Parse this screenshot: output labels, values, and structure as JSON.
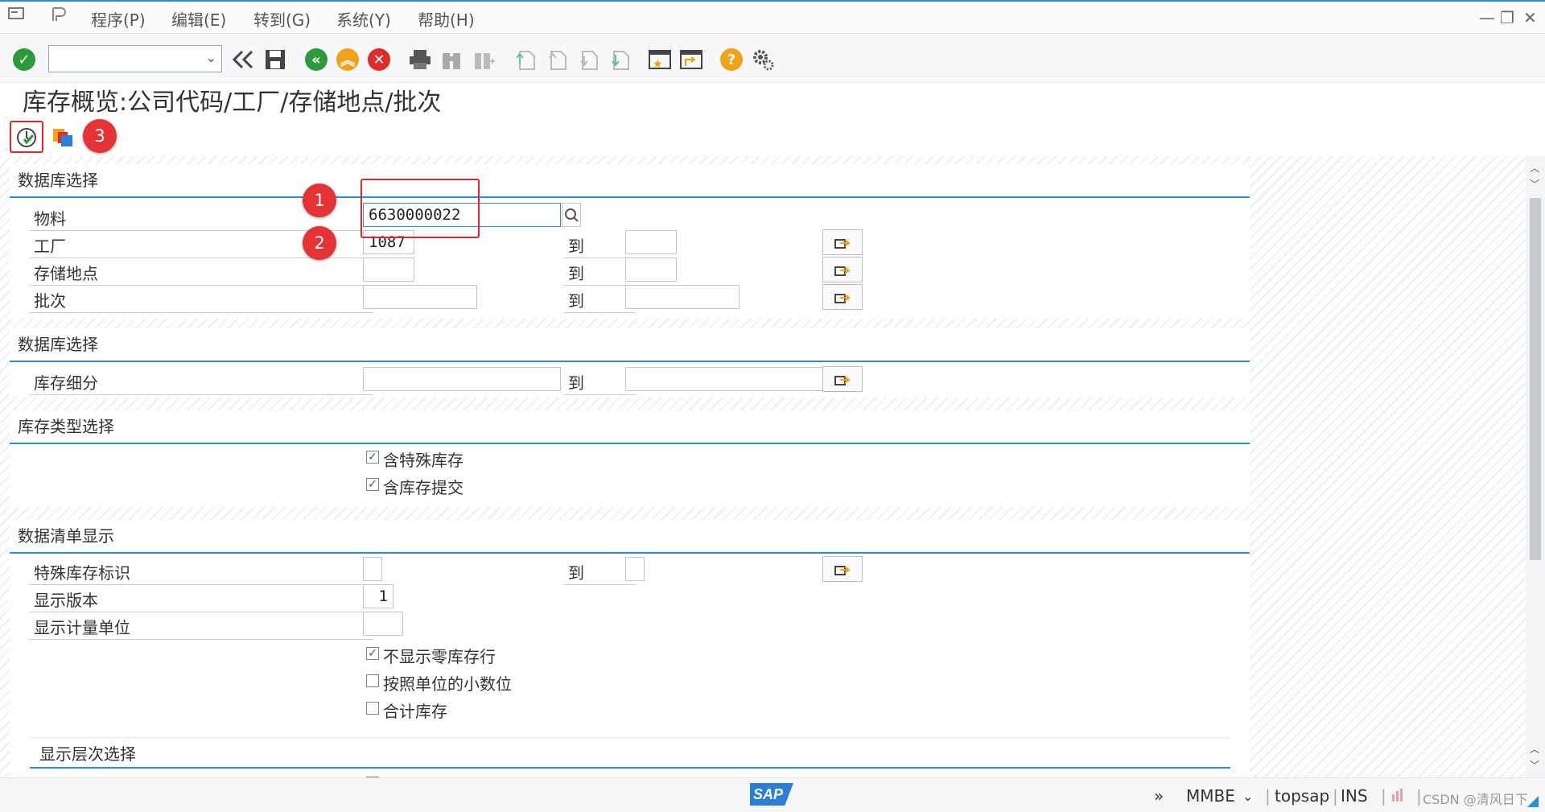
{
  "menu": {
    "items": [
      "程序(P)",
      "编辑(E)",
      "转到(G)",
      "系统(Y)",
      "帮助(H)"
    ]
  },
  "toolbar": {
    "command_value": "",
    "icons": [
      "enter-icon",
      "back-double-icon",
      "save-icon",
      "back-icon",
      "exit-icon",
      "cancel-icon",
      "print-icon",
      "find-icon",
      "find-next-icon",
      "first-page-icon",
      "prev-page-icon",
      "next-page-icon",
      "last-page-icon",
      "new-session-icon",
      "shortcut-icon",
      "help-icon",
      "settings-icon"
    ]
  },
  "page": {
    "title": "库存概览:公司代码/工厂/存储地点/批次"
  },
  "annotations": {
    "badge1": "1",
    "badge2": "2",
    "badge3": "3"
  },
  "groups": {
    "db_selection": {
      "title": "数据库选择",
      "rows": [
        {
          "label": "物料",
          "from": "6630000022"
        },
        {
          "label": "工厂",
          "from": "1087",
          "to_label": "到",
          "to": ""
        },
        {
          "label": "存储地点",
          "from": "",
          "to_label": "到",
          "to": ""
        },
        {
          "label": "批次",
          "from": "",
          "to_label": "到",
          "to": ""
        }
      ]
    },
    "db_selection2": {
      "title": "数据库选择",
      "rows": [
        {
          "label": "库存细分",
          "from": "",
          "to_label": "到",
          "to": ""
        }
      ]
    },
    "stock_type": {
      "title": "库存类型选择",
      "checkboxes": [
        {
          "label": "含特殊库存",
          "checked": true
        },
        {
          "label": "含库存提交",
          "checked": true
        }
      ]
    },
    "list_display": {
      "title": "数据清单显示",
      "special_stock_label": "特殊库存标识",
      "special_stock_to": "到",
      "version_label": "显示版本",
      "version_value": "1",
      "unit_label": "显示计量单位",
      "unit_value": "",
      "checkboxes": [
        {
          "label": "不显示零库存行",
          "checked": true
        },
        {
          "label": "按照单位的小数位",
          "checked": false
        },
        {
          "label": "合计库存",
          "checked": false
        }
      ]
    },
    "hierarchy": {
      "title": "显示层次选择"
    }
  },
  "status": {
    "logo": "SAP",
    "tcode": "MMBE",
    "server": "topsap",
    "mode": "INS",
    "watermark": "CSDN @清风日下"
  }
}
